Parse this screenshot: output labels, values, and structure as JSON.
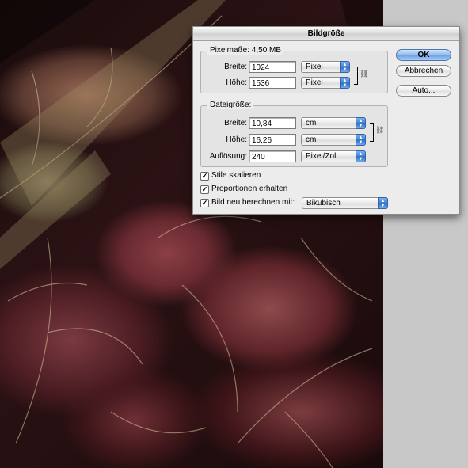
{
  "dialog": {
    "title": "Bildgröße",
    "pixel_group": {
      "legend": "Pixelmaße: 4,50 MB",
      "width_label": "Breite:",
      "width_value": "1024",
      "width_unit": "Pixel",
      "height_label": "Höhe:",
      "height_value": "1536",
      "height_unit": "Pixel"
    },
    "doc_group": {
      "legend": "Dateigröße:",
      "width_label": "Breite:",
      "width_value": "10,84",
      "width_unit": "cm",
      "height_label": "Höhe:",
      "height_value": "16,26",
      "height_unit": "cm",
      "resolution_label": "Auflösung:",
      "resolution_value": "240",
      "resolution_unit": "Pixel/Zoll"
    },
    "options": {
      "scale_styles": {
        "label": "Stile skalieren",
        "checked": true
      },
      "constrain": {
        "label": "Proportionen erhalten",
        "checked": true
      },
      "resample": {
        "label": "Bild neu berechnen mit:",
        "checked": true,
        "method": "Bikubisch"
      }
    },
    "buttons": {
      "ok": "OK",
      "cancel": "Abbrechen",
      "auto": "Auto..."
    }
  },
  "icons": {
    "check_glyph": "✓",
    "popup_arrows": "▲▼",
    "chain_glyph": "⛓"
  },
  "colors": {
    "default_button": "#6c9fe0",
    "popup_accent": "#3c7fd4"
  }
}
